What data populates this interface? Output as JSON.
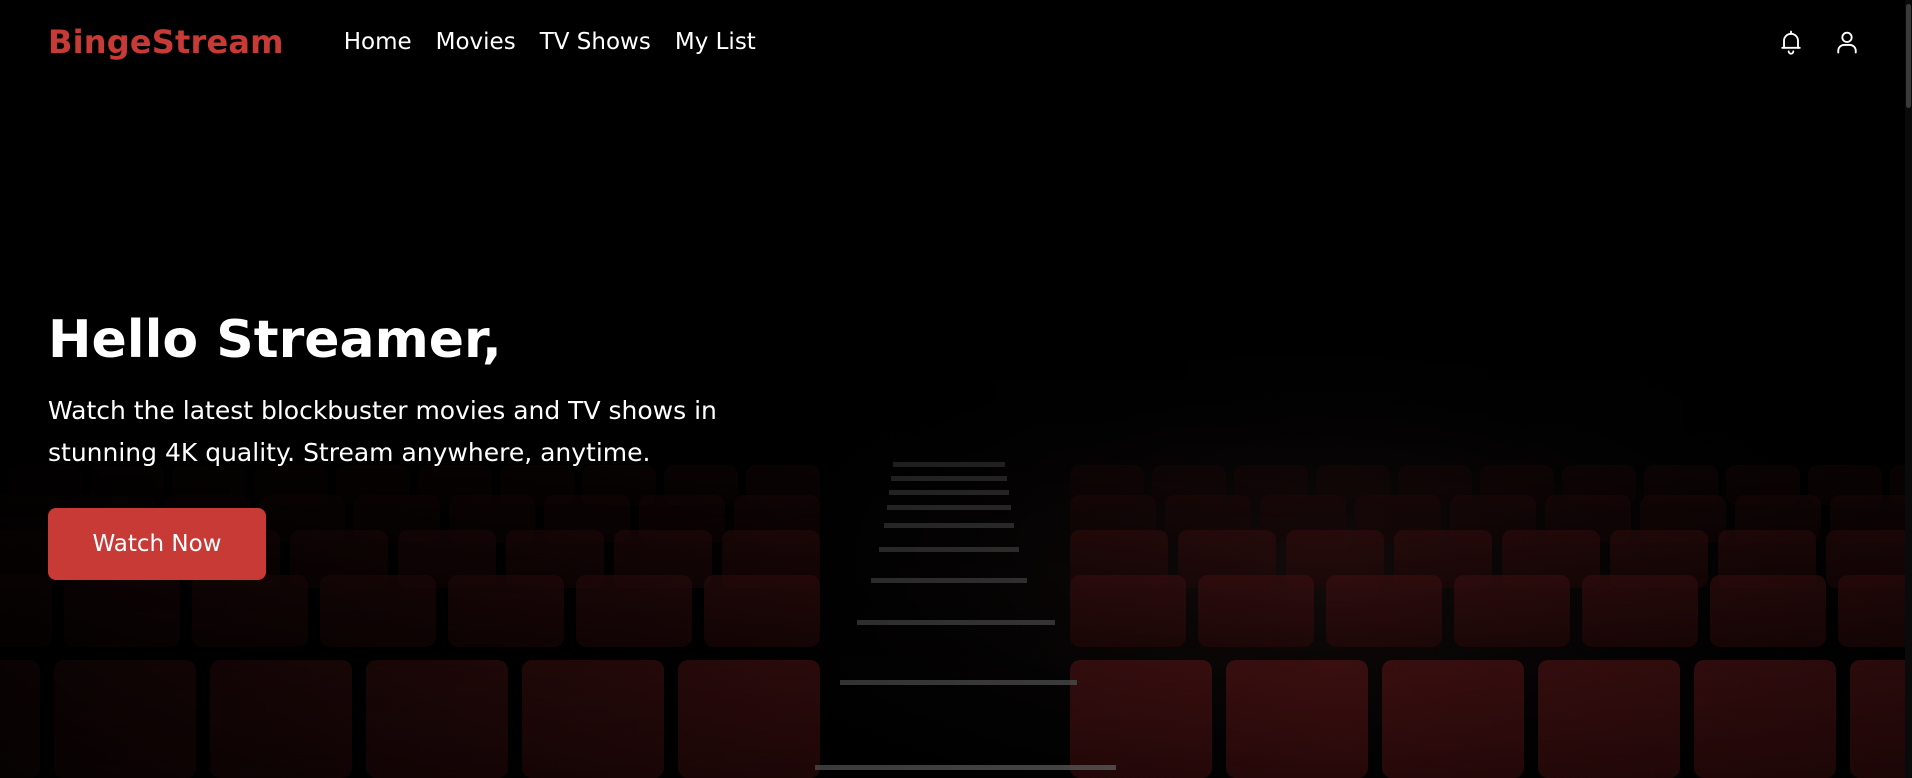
{
  "header": {
    "brand": "BingeStream",
    "nav": [
      {
        "label": "Home"
      },
      {
        "label": "Movies"
      },
      {
        "label": "TV Shows"
      },
      {
        "label": "My List"
      }
    ],
    "icons": [
      "bell-icon",
      "user-icon"
    ]
  },
  "hero": {
    "title": "Hello Streamer,",
    "subtitle": "Watch the latest blockbuster movies and TV shows in stunning 4K quality. Stream anywhere, anytime.",
    "cta_label": "Watch Now",
    "background": "cinema-seats-image"
  },
  "colors": {
    "accent": "#c73a36",
    "background": "#000000",
    "text": "#ffffff",
    "seat": "#5a1416"
  }
}
